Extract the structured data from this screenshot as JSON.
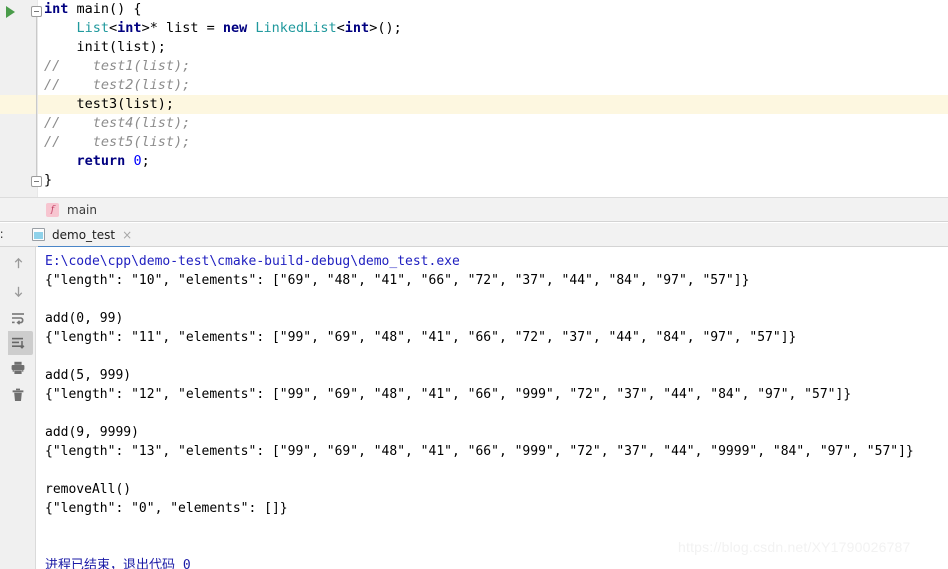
{
  "editor": {
    "run_arrow": "run-icon",
    "lines": [
      {
        "indent": 0,
        "tokens": [
          {
            "t": "int",
            "c": "k"
          },
          {
            "t": " main() {",
            "c": "pl"
          }
        ]
      },
      {
        "indent": 1,
        "tokens": [
          {
            "t": "List",
            "c": "cls"
          },
          {
            "t": "<",
            "c": "pl"
          },
          {
            "t": "int",
            "c": "k"
          },
          {
            "t": ">* list = ",
            "c": "pl"
          },
          {
            "t": "new",
            "c": "k"
          },
          {
            "t": " ",
            "c": "pl"
          },
          {
            "t": "LinkedList",
            "c": "cls"
          },
          {
            "t": "<",
            "c": "pl"
          },
          {
            "t": "int",
            "c": "k"
          },
          {
            "t": ">();",
            "c": "pl"
          }
        ]
      },
      {
        "indent": 1,
        "tokens": [
          {
            "t": "init(list);",
            "c": "pl"
          }
        ]
      },
      {
        "indent": 0,
        "tokens": [
          {
            "t": "//    test1(list);",
            "c": "cmt"
          }
        ]
      },
      {
        "indent": 0,
        "tokens": [
          {
            "t": "//    test2(list);",
            "c": "cmt"
          }
        ]
      },
      {
        "indent": 1,
        "highlight": true,
        "tokens": [
          {
            "t": "test3(list);",
            "c": "pl"
          }
        ]
      },
      {
        "indent": 0,
        "tokens": [
          {
            "t": "//    test4(list);",
            "c": "cmt"
          }
        ]
      },
      {
        "indent": 0,
        "tokens": [
          {
            "t": "//    test5(list);",
            "c": "cmt"
          }
        ]
      },
      {
        "indent": 1,
        "tokens": [
          {
            "t": "return",
            "c": "k"
          },
          {
            "t": " ",
            "c": "pl"
          },
          {
            "t": "0",
            "c": "num"
          },
          {
            "t": ";",
            "c": "pl"
          }
        ]
      },
      {
        "indent": 0,
        "tokens": [
          {
            "t": "}",
            "c": "pl"
          }
        ]
      }
    ]
  },
  "breadcrumb": {
    "icon": "function-icon",
    "icon_letter": "f",
    "label": "main"
  },
  "run_tool": {
    "window_label": "n:",
    "tab": {
      "icon": "console-icon",
      "title": "demo_test",
      "close": "×"
    },
    "sidebar_buttons": [
      {
        "name": "scroll-up-button",
        "icon": "arrow-up-icon",
        "active": false
      },
      {
        "name": "scroll-down-button",
        "icon": "arrow-down-icon",
        "active": false
      },
      {
        "name": "soft-wrap-button",
        "icon": "soft-wrap-icon",
        "active": false
      },
      {
        "name": "scroll-to-end-button",
        "icon": "scroll-to-end-icon",
        "active": true
      },
      {
        "name": "print-button",
        "icon": "printer-icon",
        "active": false
      },
      {
        "name": "clear-all-button",
        "icon": "trash-icon",
        "active": false
      }
    ],
    "console_lines": [
      {
        "text": "E:\\code\\cpp\\demo-test\\cmake-build-debug\\demo_test.exe",
        "style": "cmd"
      },
      {
        "text": "{\"length\": \"10\", \"elements\": [\"69\", \"48\", \"41\", \"66\", \"72\", \"37\", \"44\", \"84\", \"97\", \"57\"]}",
        "style": ""
      },
      {
        "text": "",
        "style": ""
      },
      {
        "text": "add(0, 99)",
        "style": ""
      },
      {
        "text": "{\"length\": \"11\", \"elements\": [\"99\", \"69\", \"48\", \"41\", \"66\", \"72\", \"37\", \"44\", \"84\", \"97\", \"57\"]}",
        "style": ""
      },
      {
        "text": "",
        "style": ""
      },
      {
        "text": "add(5, 999)",
        "style": ""
      },
      {
        "text": "{\"length\": \"12\", \"elements\": [\"99\", \"69\", \"48\", \"41\", \"66\", \"999\", \"72\", \"37\", \"44\", \"84\", \"97\", \"57\"]}",
        "style": ""
      },
      {
        "text": "",
        "style": ""
      },
      {
        "text": "add(9, 9999)",
        "style": ""
      },
      {
        "text": "{\"length\": \"13\", \"elements\": [\"99\", \"69\", \"48\", \"41\", \"66\", \"999\", \"72\", \"37\", \"44\", \"9999\", \"84\", \"97\", \"57\"]}",
        "style": ""
      },
      {
        "text": "",
        "style": ""
      },
      {
        "text": "removeAll()",
        "style": ""
      },
      {
        "text": "{\"length\": \"0\", \"elements\": []}",
        "style": ""
      },
      {
        "text": "",
        "style": ""
      },
      {
        "text": "",
        "style": ""
      },
      {
        "text": "进程已结束，退出代码 0",
        "style": "blue"
      }
    ]
  },
  "watermark": {
    "text": "https://blog.csdn.net/XY1790026787"
  },
  "colors": {
    "keyword": "#000080",
    "class_name": "#20999d",
    "comment": "#8c8c8c",
    "number": "#0000ff",
    "console_link": "#2020c0",
    "console_exit": "#1a1aa6",
    "highlight_line": "#fdf7e0",
    "tab_underline": "#4a86c8",
    "run_arrow": "#4a9c4a",
    "breadcrumb_icon": "#f7c5d0"
  }
}
